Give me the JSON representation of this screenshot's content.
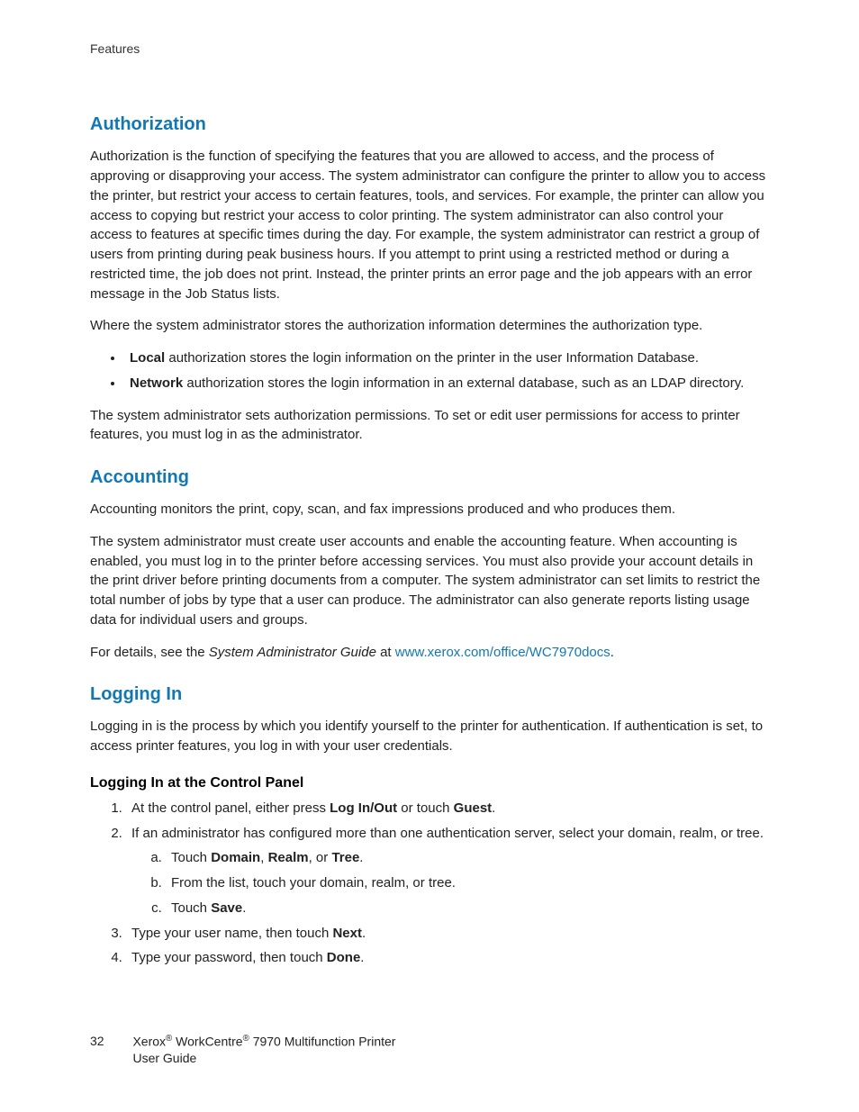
{
  "header": {
    "label": "Features"
  },
  "sections": {
    "authorization": {
      "title": "Authorization",
      "p1": "Authorization is the function of specifying the features that you are allowed to access, and the process of approving or disapproving your access. The system administrator can configure the printer to allow you to access the printer, but restrict your access to certain features, tools, and services. For example, the printer can allow you access to copying but restrict your access to color printing. The system administrator can also control your access to features at specific times during the day. For example, the system administrator can restrict a group of users from printing during peak business hours. If you attempt to print using a restricted method or during a restricted time, the job does not print. Instead, the printer prints an error page and the job appears with an error message in the Job Status lists.",
      "p2": "Where the system administrator stores the authorization information determines the authorization type.",
      "bullets": [
        {
          "bold": "Local",
          "rest": " authorization stores the login information on the printer in the user Information Database."
        },
        {
          "bold": "Network",
          "rest": " authorization stores the login information in an external database, such as an LDAP directory."
        }
      ],
      "p3": "The system administrator sets authorization permissions. To set or edit user permissions for access to printer features, you must log in as the administrator."
    },
    "accounting": {
      "title": "Accounting",
      "p1": "Accounting monitors the print, copy, scan, and fax impressions produced and who produces them.",
      "p2": "The system administrator must create user accounts and enable the accounting feature. When accounting is enabled, you must log in to the printer before accessing services. You must also provide your account details in the print driver before printing documents from a computer. The system administrator can set limits to restrict the total number of jobs by type that a user can produce. The administrator can also generate reports listing usage data for individual users and groups.",
      "p3_pre": "For details, see the ",
      "p3_italic": "System Administrator Guide",
      "p3_mid": " at ",
      "p3_link": "www.xerox.com/office/WC7970docs",
      "p3_post": "."
    },
    "loggingin": {
      "title": "Logging In",
      "p1": "Logging in is the process by which you identify yourself to the printer for authentication. If authentication is set, to access printer features, you log in with your user credentials.",
      "sub_title": "Logging In at the Control Panel",
      "step1_pre": "At the control panel, either press ",
      "step1_b1": "Log In/Out",
      "step1_mid": " or touch ",
      "step1_b2": "Guest",
      "step1_post": ".",
      "step2": "If an administrator has configured more than one authentication server, select your domain, realm, or tree.",
      "step2a_pre": "Touch ",
      "step2a_b1": "Domain",
      "step2a_sep1": ", ",
      "step2a_b2": "Realm",
      "step2a_sep2": ", or ",
      "step2a_b3": "Tree",
      "step2a_post": ".",
      "step2b": "From the list, touch your domain, realm, or tree.",
      "step2c_pre": "Touch ",
      "step2c_b": "Save",
      "step2c_post": ".",
      "step3_pre": "Type your user name, then touch ",
      "step3_b": "Next",
      "step3_post": ".",
      "step4_pre": "Type your password, then touch ",
      "step4_b": "Done",
      "step4_post": "."
    }
  },
  "footer": {
    "page_number": "32",
    "brand_pre": "Xerox",
    "brand_mid": " WorkCentre",
    "brand_post": " 7970 Multifunction Printer",
    "line2": "User Guide",
    "reg": "®"
  }
}
